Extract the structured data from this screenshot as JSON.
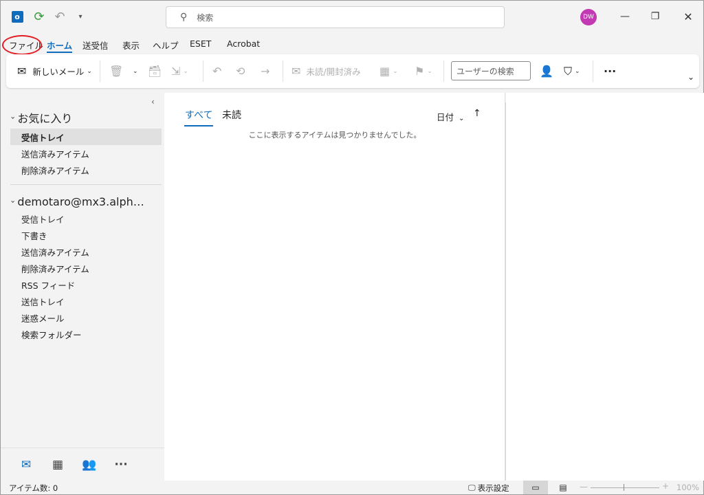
{
  "titlebar": {
    "search_placeholder": "検索",
    "avatar_initials": "DW"
  },
  "menu": {
    "tabs": [
      "ファイル",
      "ホーム",
      "送受信",
      "表示",
      "ヘルプ",
      "ESET",
      "Acrobat"
    ],
    "active": "ホーム"
  },
  "ribbon": {
    "new_mail": "新しいメール",
    "read_unread": "未読/開封済み",
    "people_search": "ユーザーの検索"
  },
  "folders": {
    "favorites": {
      "title": "お気に入り",
      "items": [
        "受信トレイ",
        "送信済みアイテム",
        "削除済みアイテム"
      ]
    },
    "account": {
      "title": "demotaro@mx3.alph…",
      "items": [
        "受信トレイ",
        "下書き",
        "送信済みアイテム",
        "削除済みアイテム",
        "RSS フィード",
        "送信トレイ",
        "迷惑メール",
        "検索フォルダー"
      ]
    }
  },
  "list": {
    "tab_all": "すべて",
    "tab_unread": "未読",
    "sort_label": "日付",
    "empty_message": "ここに表示するアイテムは見つかりませんでした。"
  },
  "status": {
    "item_count": "アイテム数: 0",
    "display_settings": "表示設定",
    "zoom": "100%"
  },
  "colors": {
    "accent": "#0f6cbd",
    "annotation_circle": "#e31b23",
    "avatar": "#c239b3"
  }
}
